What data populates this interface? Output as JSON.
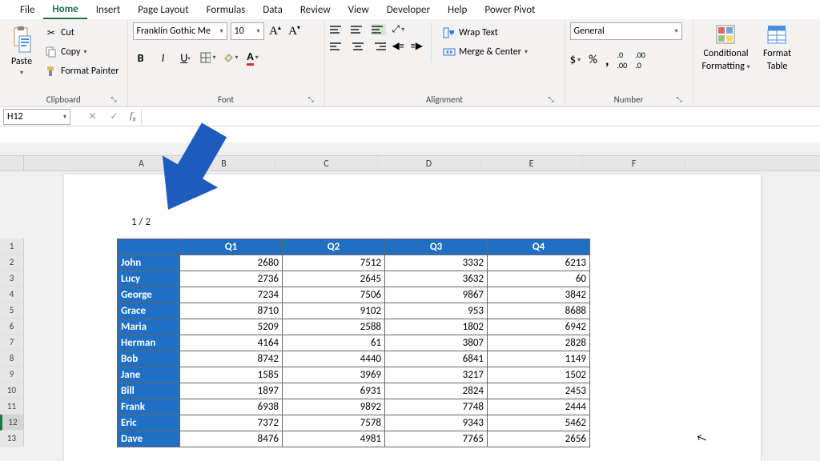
{
  "menu": {
    "tabs": [
      "File",
      "Home",
      "Insert",
      "Page Layout",
      "Formulas",
      "Data",
      "Review",
      "View",
      "Developer",
      "Help",
      "Power Pivot"
    ],
    "active": "Home"
  },
  "ribbon": {
    "clipboard": {
      "paste": "Paste",
      "cut": "Cut",
      "copy": "Copy",
      "format_painter": "Format Painter",
      "label": "Clipboard"
    },
    "font": {
      "name": "Franklin Gothic Me",
      "size": "10",
      "label": "Font"
    },
    "alignment": {
      "wrap_text": "Wrap Text",
      "merge_center": "Merge & Center",
      "label": "Alignment"
    },
    "number": {
      "format": "General",
      "label": "Number"
    },
    "styles": {
      "conditional": "Conditional",
      "formatting": "Formatting",
      "format_as": "Format",
      "table": "Table"
    }
  },
  "namebox": "H12",
  "page_header": "1 / 2",
  "chart_data": {
    "type": "table",
    "title": "",
    "columns": [
      "",
      "Q1",
      "Q2",
      "Q3",
      "Q4"
    ],
    "rows": [
      {
        "name": "John",
        "Q1": 2680,
        "Q2": 7512,
        "Q3": 3332,
        "Q4": 6213
      },
      {
        "name": "Lucy",
        "Q1": 2736,
        "Q2": 2645,
        "Q3": 3632,
        "Q4": 60
      },
      {
        "name": "George",
        "Q1": 7234,
        "Q2": 7506,
        "Q3": 9867,
        "Q4": 3842
      },
      {
        "name": "Grace",
        "Q1": 8710,
        "Q2": 9102,
        "Q3": 953,
        "Q4": 8688
      },
      {
        "name": "Maria",
        "Q1": 5209,
        "Q2": 2588,
        "Q3": 1802,
        "Q4": 6942
      },
      {
        "name": "Herman",
        "Q1": 4164,
        "Q2": 61,
        "Q3": 3807,
        "Q4": 2828
      },
      {
        "name": "Bob",
        "Q1": 8742,
        "Q2": 4440,
        "Q3": 6841,
        "Q4": 1149
      },
      {
        "name": "Jane",
        "Q1": 1585,
        "Q2": 3969,
        "Q3": 3217,
        "Q4": 1502
      },
      {
        "name": "Bill",
        "Q1": 1897,
        "Q2": 6931,
        "Q3": 2824,
        "Q4": 2453
      },
      {
        "name": "Frank",
        "Q1": 6938,
        "Q2": 9892,
        "Q3": 7748,
        "Q4": 2444
      },
      {
        "name": "Eric",
        "Q1": 7372,
        "Q2": 7578,
        "Q3": 9343,
        "Q4": 5462
      },
      {
        "name": "Dave",
        "Q1": 8476,
        "Q2": 4981,
        "Q3": 7765,
        "Q4": 2656
      }
    ]
  },
  "col_letters": [
    "A",
    "B",
    "C",
    "D",
    "E",
    "F"
  ],
  "row_numbers": [
    1,
    2,
    3,
    4,
    5,
    6,
    7,
    8,
    9,
    10,
    11,
    12,
    13
  ],
  "selected_row": 12
}
